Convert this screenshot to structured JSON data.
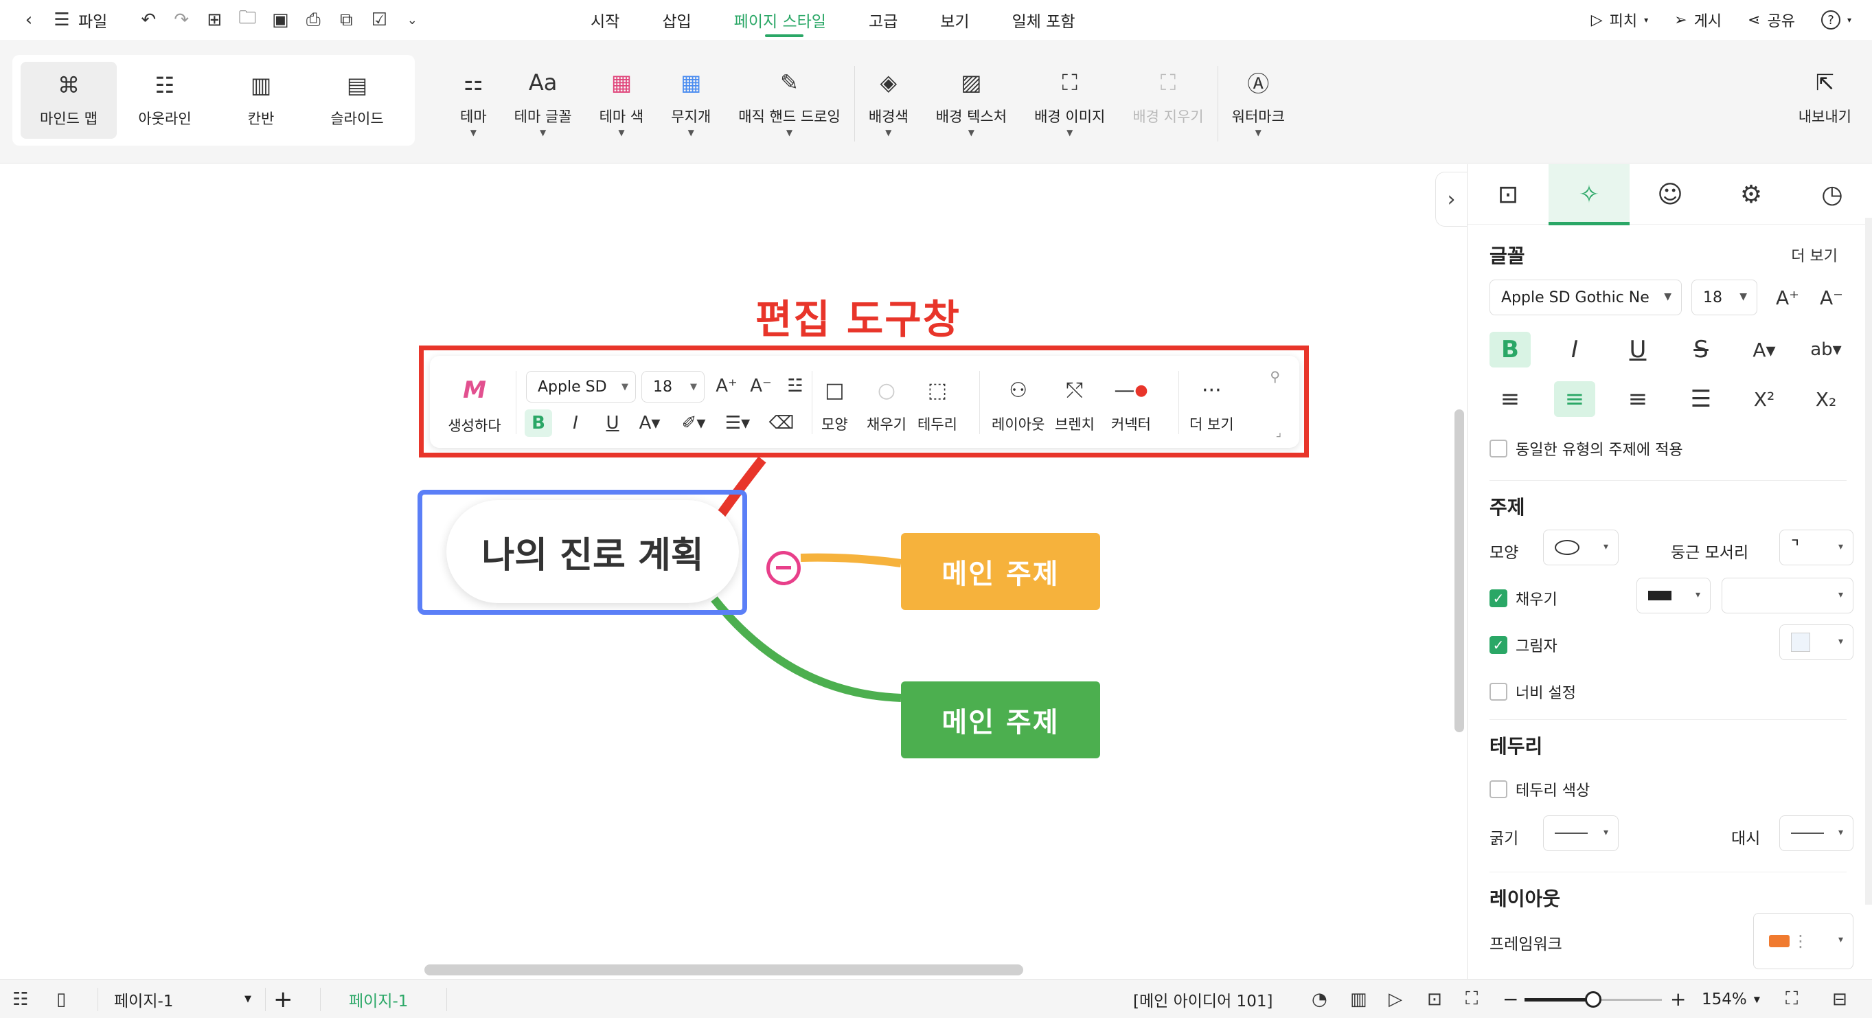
{
  "menubar": {
    "file_label": "파일",
    "tabs": [
      "시작",
      "삽입",
      "페이지 스타일",
      "고급",
      "보기",
      "일체 포함"
    ],
    "active_tab": "페이지 스타일",
    "pitch_label": "피치",
    "publish_label": "게시",
    "share_label": "공유",
    "help_label": "?"
  },
  "ribbon": {
    "views": [
      {
        "label": "마인드 맵",
        "icon": "mindmap-icon",
        "active": true
      },
      {
        "label": "아웃라인",
        "icon": "outline-icon",
        "active": false
      },
      {
        "label": "칸반",
        "icon": "kanban-icon",
        "active": false
      },
      {
        "label": "슬라이드",
        "icon": "slide-icon",
        "active": false
      }
    ],
    "tools": [
      {
        "label": "테마",
        "icon": "theme-icon"
      },
      {
        "label": "테마 글꼴",
        "icon": "theme-font-icon"
      },
      {
        "label": "테마 색",
        "icon": "theme-color-icon"
      },
      {
        "label": "무지개",
        "icon": "rainbow-icon"
      },
      {
        "label": "매직 핸드 드로잉",
        "icon": "magic-draw-icon"
      },
      {
        "label": "배경색",
        "icon": "bg-color-icon"
      },
      {
        "label": "배경 텍스처",
        "icon": "bg-texture-icon"
      },
      {
        "label": "배경 이미지",
        "icon": "bg-image-icon"
      },
      {
        "label": "배경 지우기",
        "icon": "bg-clear-icon"
      },
      {
        "label": "워터마크",
        "icon": "watermark-icon"
      }
    ],
    "export_label": "내보내기"
  },
  "canvas": {
    "annotation_title": "편집 도구창",
    "central_topic": "나의 진로 계획",
    "main_topics": [
      "메인 주제",
      "메인 주제"
    ],
    "colors": {
      "annotation_red": "#e8352a",
      "annotation_blue": "#5b7ff7",
      "orange": "#f6b23c",
      "green": "#4caf4f",
      "branch_pink": "#e83f8a"
    }
  },
  "floating_toolbar": {
    "generate_label": "생성하다",
    "font_name": "Apple SD",
    "font_size": "18",
    "shape_label": "모양",
    "fill_label": "채우기",
    "border_label": "테두리",
    "layout_label": "레이아웃",
    "branch_label": "브렌치",
    "connector_label": "커넥터",
    "more_label": "더 보기"
  },
  "panel": {
    "font_section": "글꼴",
    "more_label": "더 보기",
    "font_name": "Apple SD Gothic Ne",
    "font_size": "18",
    "apply_same_label": "동일한 유형의 주제에 적용",
    "topic_section": "주제",
    "shape_label": "모양",
    "round_corner_label": "둥근 모서리",
    "fill_label": "채우기",
    "shadow_label": "그림자",
    "width_label": "너비 설정",
    "border_section": "테두리",
    "border_color_label": "테두리 색상",
    "thickness_label": "굵기",
    "dash_label": "대시",
    "layout_section": "레이아웃",
    "framework_label": "프레임워크",
    "fill_checked": true,
    "shadow_checked": true
  },
  "statusbar": {
    "page_select": "페이지-1",
    "page_tab": "페이지-1",
    "node_info": "[메인 아이디어 101]",
    "zoom": "154%",
    "zoom_fraction": 0.5
  }
}
